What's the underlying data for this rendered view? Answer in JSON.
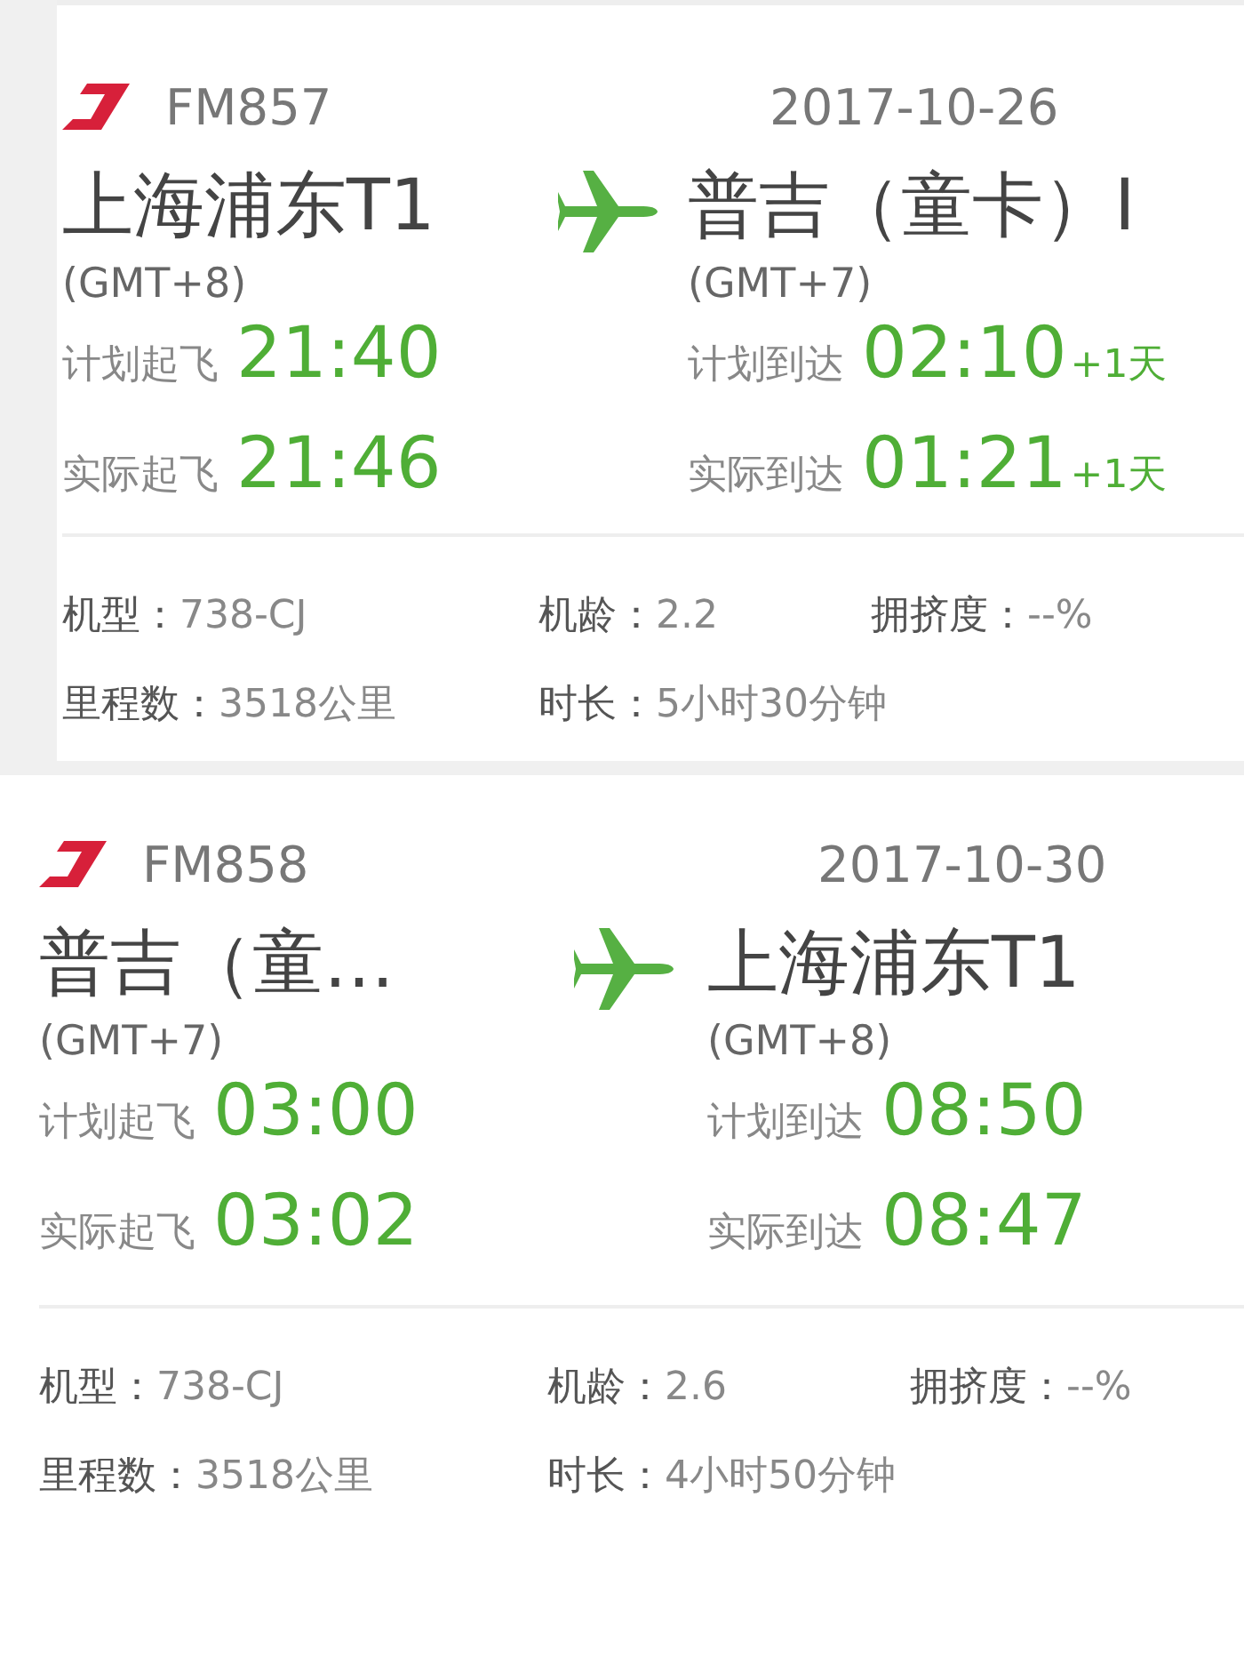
{
  "flights": [
    {
      "flight_no": "FM857",
      "date": "2017-10-26",
      "departure": {
        "city": "上海浦东T1",
        "timezone": "(GMT+8)",
        "times": [
          {
            "label": "计划起飞",
            "time": "21:40"
          },
          {
            "label": "实际起飞",
            "time": "21:46"
          }
        ]
      },
      "arrival": {
        "city": "普吉（童卡）I",
        "timezone": "(GMT+7)",
        "times": [
          {
            "label": "计划到达",
            "time": "02:10",
            "day_offset": "+1天"
          },
          {
            "label": "实际到达",
            "time": "01:21",
            "day_offset": "+1天"
          }
        ]
      },
      "details": [
        {
          "label": "机型：",
          "value": "738-CJ"
        },
        {
          "label": "机龄：",
          "value": "2.2"
        },
        {
          "label": "拥挤度：",
          "value": "--%"
        },
        {
          "label": "里程数：",
          "value": "3518公里"
        },
        {
          "label": "时长：",
          "value": "5小时30分钟"
        }
      ]
    },
    {
      "flight_no": "FM858",
      "date": "2017-10-30",
      "departure": {
        "city": "普吉（童…",
        "timezone": "(GMT+7)",
        "times": [
          {
            "label": "计划起飞",
            "time": "03:00"
          },
          {
            "label": "实际起飞",
            "time": "03:02"
          }
        ]
      },
      "arrival": {
        "city": "上海浦东T1",
        "timezone": "(GMT+8)",
        "times": [
          {
            "label": "计划到达",
            "time": "08:50"
          },
          {
            "label": "实际到达",
            "time": "08:47"
          }
        ]
      },
      "details": [
        {
          "label": "机型：",
          "value": "738-CJ"
        },
        {
          "label": "机龄：",
          "value": "2.6"
        },
        {
          "label": "拥挤度：",
          "value": "--%"
        },
        {
          "label": "里程数：",
          "value": "3518公里"
        },
        {
          "label": "时长：",
          "value": "4小时50分钟"
        }
      ]
    }
  ]
}
